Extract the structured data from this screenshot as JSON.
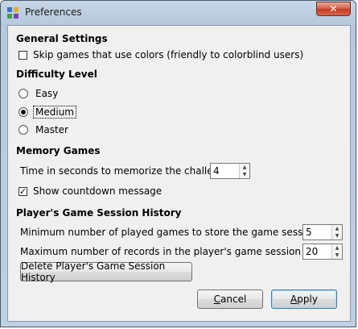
{
  "window": {
    "title": "Preferences",
    "close_glyph": "✕"
  },
  "general": {
    "heading": "General Settings",
    "skip_colors": {
      "label": "Skip games that use colors (friendly to colorblind users)",
      "checked": false
    }
  },
  "difficulty": {
    "heading": "Difficulty Level",
    "options": [
      {
        "label": "Easy",
        "selected": false
      },
      {
        "label": "Medium",
        "selected": true
      },
      {
        "label": "Master",
        "selected": false
      }
    ]
  },
  "memory": {
    "heading": "Memory Games",
    "memorize_label": "Time in seconds to memorize the challenge:",
    "memorize_value": "4",
    "countdown": {
      "label": "Show countdown message",
      "checked": true
    }
  },
  "history": {
    "heading": "Player's Game Session History",
    "min_games_label": "Minimum number of played games to store the game session:",
    "min_games_value": "5",
    "max_records_label": "Maximum number of records in the player's game session history:",
    "max_records_value": "20",
    "delete_button": "Delete Player's Game Session History"
  },
  "buttons": {
    "cancel_label": "Cancel",
    "cancel_mnemonic": "C",
    "cancel_rest": "ancel",
    "apply_label": "Apply",
    "apply_mnemonic": "A",
    "apply_rest": "pply"
  },
  "colors": {
    "title_bar": "#bfd0e2",
    "close_button": "#c23a20",
    "client_bg": "#f0f0f0"
  },
  "icons": [
    "app-icon",
    "close-icon",
    "check-icon",
    "spin-up-icon",
    "spin-down-icon"
  ]
}
